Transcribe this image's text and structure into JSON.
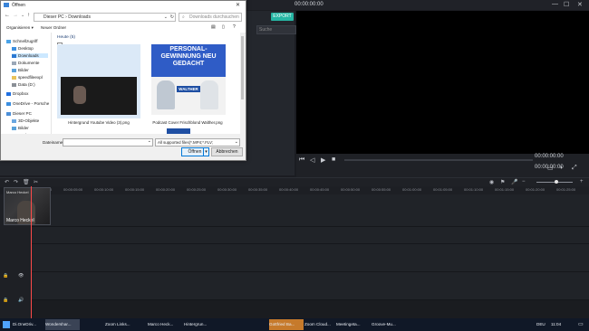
{
  "editor": {
    "timecode_top": "00:00:00:00",
    "export_label": "EXPORT",
    "media_search_placeholder": "Suche",
    "preview_time_left": "00:00:00:00",
    "preview_time_right": "00:00:00:00",
    "ruler_ticks": [
      "00:00:00:00",
      "00:00:05:00",
      "00:00:10:00",
      "00:00:15:00",
      "00:00:20:00",
      "00:00:25:00",
      "00:00:30:00",
      "00:00:35:00",
      "00:00:40:00",
      "00:00:45:00",
      "00:00:50:00",
      "00:00:55:00",
      "00:01:00:00",
      "00:01:05:00",
      "00:01:10:00",
      "00:01:15:00",
      "00:01:20:00",
      "00:01:25:00"
    ],
    "clip_label": "Marco Heckel",
    "clip_title": "Marco Heckel"
  },
  "dialog": {
    "title": "Öffnen",
    "breadcrumb": "Dieser PC  ›  Downloads",
    "search_placeholder": "Downloads durchsuchen",
    "organize": "Organisieren ▾",
    "new_folder": "Neuer Ordner",
    "group_header": "Heute (5)",
    "nav_items": [
      "Schnellzugriff",
      "Desktop",
      "Downloads",
      "Dokumente",
      "Bilder",
      "speedfileexpl",
      "Data (D:)",
      "Dropbox",
      "OneDrive - Porsche",
      "Dieser PC",
      "3D-Objekte",
      "Bilder",
      "Desktop"
    ],
    "files": [
      {
        "name": "Hintergrund Youtube Video (3).png"
      },
      {
        "name": "Podcast Cover Frischblond Walther.png"
      }
    ],
    "thumb2_heading": "PERSONAL-GEWINNUNG NEU GEDACHT",
    "thumb2_brand": "WALTHER",
    "filename_label": "Dateiname:",
    "filetype_value": "All supported files(*.MP4;*.FLV;",
    "open_label": "Öffnen",
    "cancel_label": "Abbrechen"
  },
  "taskbar": {
    "items": [
      "Di.OneDriv...",
      "Wondershar...",
      "",
      "Zoom Links...",
      "Marco Heck...",
      "Hintergrun...",
      "",
      "Gottfried Ba...",
      "Zoom Cloud...",
      "Meetingeta...",
      "Groove-Mu..."
    ],
    "lang": "DEU",
    "clock": "11:04"
  },
  "colors": {
    "accent": "#26b6a4",
    "playhead": "#ff4a4a",
    "taskbar": "#101827"
  }
}
